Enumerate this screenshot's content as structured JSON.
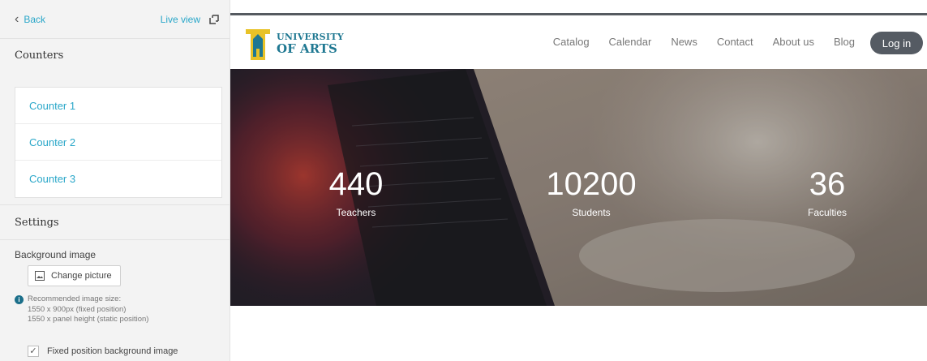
{
  "panel": {
    "back_label": "Back",
    "live_view_label": "Live view",
    "counters_title": "Counters",
    "counters": [
      {
        "label": "Counter 1"
      },
      {
        "label": "Counter 2"
      },
      {
        "label": "Counter 3"
      }
    ],
    "settings_title": "Settings",
    "background_image_label": "Background image",
    "change_picture_label": "Change picture",
    "recommended": {
      "line1": "Recommended image size:",
      "line2": "1550 x 900px (fixed position)",
      "line3": "1550 x panel height (static position)"
    },
    "fixed_bg_label": "Fixed position background image",
    "fixed_bg_checked": true
  },
  "site": {
    "logo_line1": "UNIVERSITY",
    "logo_line2": "OF ARTS",
    "nav": [
      "Catalog",
      "Calendar",
      "News",
      "Contact",
      "About us",
      "Blog"
    ],
    "login_label": "Log in",
    "stats": [
      {
        "value": "440",
        "label": "Teachers"
      },
      {
        "value": "10200",
        "label": "Students"
      },
      {
        "value": "36",
        "label": "Faculties"
      }
    ]
  },
  "colors": {
    "accent": "#2aa7c9",
    "logo_blue": "#1f7892",
    "logo_yellow": "#e8c227",
    "login_bg": "#555b63"
  },
  "icons": {
    "back": "chevron-left-icon",
    "live_view": "external-window-icon",
    "picture": "image-icon",
    "info": "info-icon",
    "collapse": "chevron-left-icon"
  }
}
